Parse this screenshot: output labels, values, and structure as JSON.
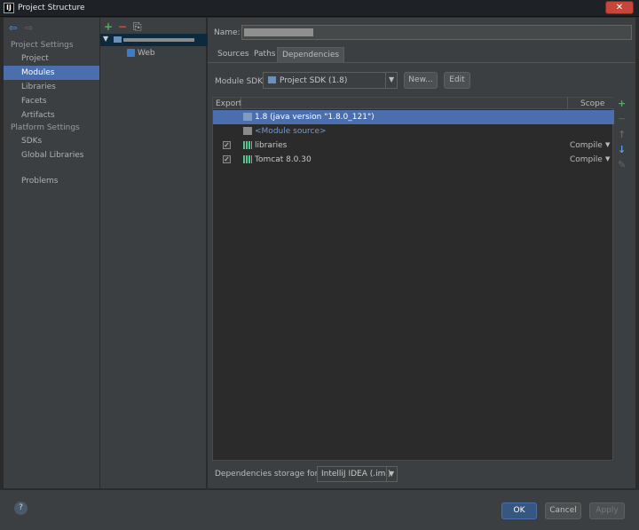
{
  "window": {
    "title": "Project Structure",
    "icon_label": "IJ",
    "close_symbol": "✕"
  },
  "nav": {
    "back_symbol": "⇦",
    "forward_symbol": "⇨",
    "project_settings_heading": "Project Settings",
    "project_settings_items": [
      "Project",
      "Modules",
      "Libraries",
      "Facets",
      "Artifacts"
    ],
    "platform_settings_heading": "Platform Settings",
    "platform_settings_items": [
      "SDKs",
      "Global Libraries"
    ],
    "problems_label": "Problems",
    "selected": "Modules"
  },
  "module_tree": {
    "add_symbol": "+",
    "remove_symbol": "−",
    "copy_symbol": "⎘",
    "child_label": "Web"
  },
  "module": {
    "name_label": "Name:",
    "tabs": [
      "Sources",
      "Paths",
      "Dependencies"
    ],
    "active_tab": "Dependencies",
    "sdk_label": "Module SDK:",
    "sdk_value": "Project SDK (1.8)",
    "new_button": "New...",
    "edit_button": "Edit",
    "table_headers": {
      "export": "Export",
      "scope": "Scope"
    },
    "dependencies": [
      {
        "label": "1.8 (java version \"1.8.0_121\")",
        "checked": false,
        "scope": "",
        "kind": "sdk",
        "selected": true
      },
      {
        "label": "<Module source>",
        "checked": false,
        "scope": "",
        "kind": "source",
        "selected": false
      },
      {
        "label": "libraries",
        "checked": true,
        "scope": "Compile",
        "kind": "lib",
        "selected": false
      },
      {
        "label": "Tomcat 8.0.30",
        "checked": true,
        "scope": "Compile",
        "kind": "lib",
        "selected": false
      }
    ],
    "side_tools": [
      "+",
      "−",
      "↑",
      "↓",
      "✎"
    ],
    "storage_format_label": "Dependencies storage format:",
    "storage_format_value": "IntelliJ IDEA (.iml)"
  },
  "footer": {
    "help_symbol": "?",
    "ok": "OK",
    "cancel": "Cancel",
    "apply": "Apply"
  },
  "colors": {
    "selection": "#4b6eaf",
    "add_green": "#59a869",
    "remove_red": "#c75450",
    "ok_blue": "#365880"
  }
}
